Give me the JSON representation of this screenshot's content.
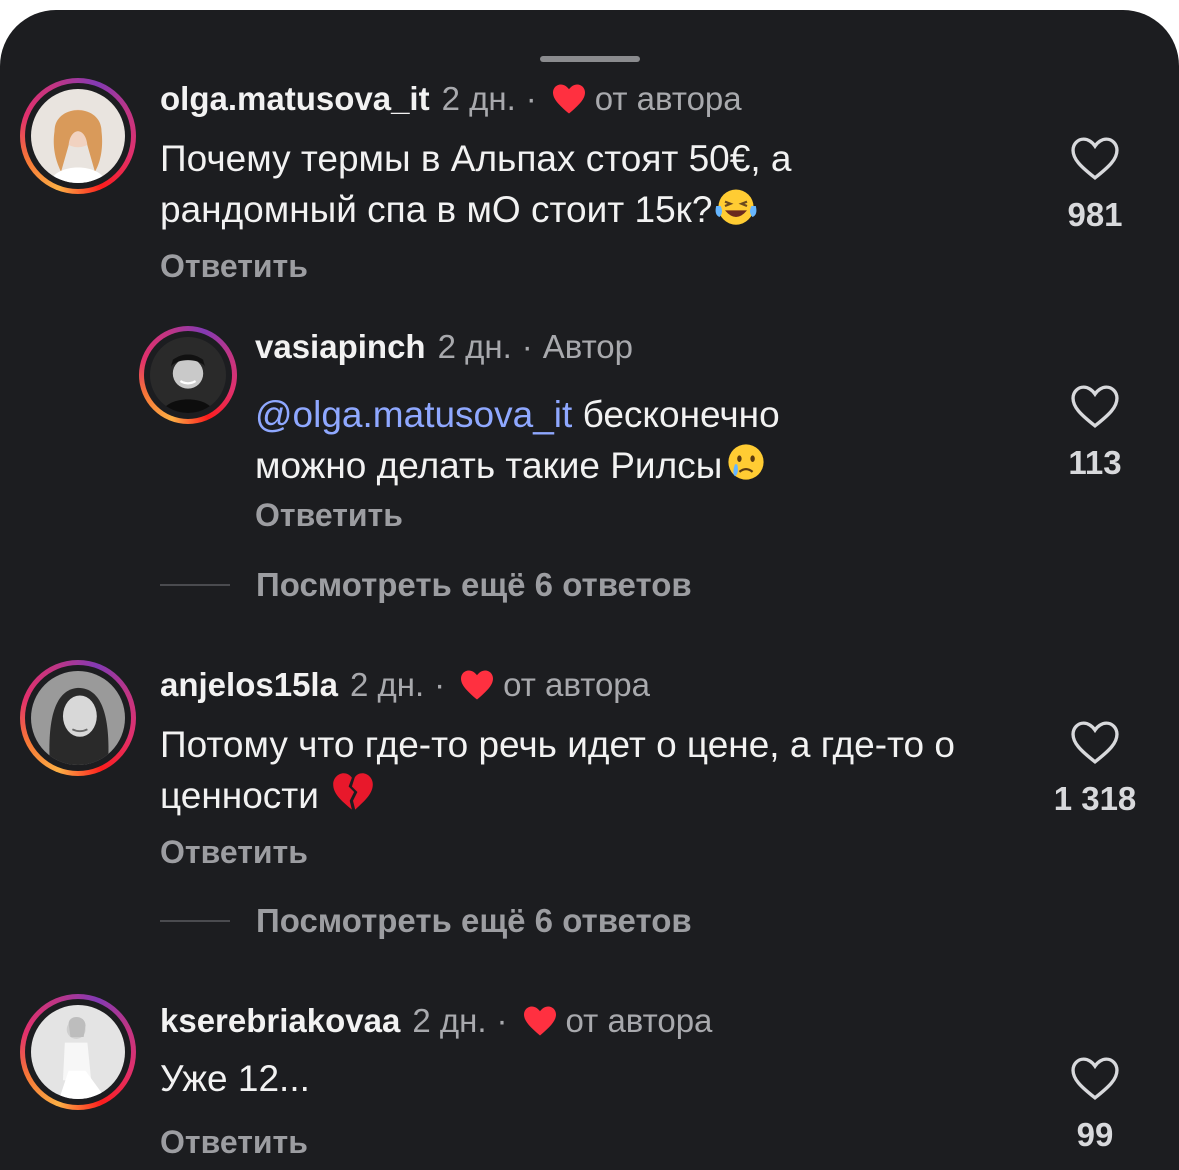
{
  "comments": [
    {
      "username": "olga.matusova_it",
      "time": "2 дн.",
      "dot": "·",
      "badge": "от автора",
      "text": "Почему термы в Альпах стоят 50€, а рандомный спа в мО стоит 15к?",
      "emoji": "laughing-tears",
      "reply": "Ответить",
      "likes": "981"
    },
    {
      "username": "vasiapinch",
      "time": "2 дн.",
      "dot": "·",
      "badge": "Автор",
      "mention": "@olga.matusova_it",
      "text": "бесконечно можно делать такие Рилсы",
      "emoji": "crying-face",
      "reply": "Ответить",
      "likes": "113"
    },
    {
      "username": "anjelos15la",
      "time": "2 дн.",
      "dot": "·",
      "badge": "от автора",
      "text": "Потому что где-то речь идет о цене, а где-то о ценности",
      "emoji": "broken-heart",
      "reply": "Ответить",
      "likes": "1 318"
    },
    {
      "username": "kserebriakovaa",
      "time": "2 дн.",
      "dot": "·",
      "badge": "от автора",
      "text": "Уже 12...",
      "reply": "Ответить",
      "likes": "99"
    }
  ],
  "view_more_1": "Посмотреть ещё 6 ответов",
  "view_more_2": "Посмотреть ещё 6 ответов",
  "colors": {
    "background": "#1c1d20",
    "heart_red": "#ff3040",
    "mention": "#8fa8ff"
  }
}
